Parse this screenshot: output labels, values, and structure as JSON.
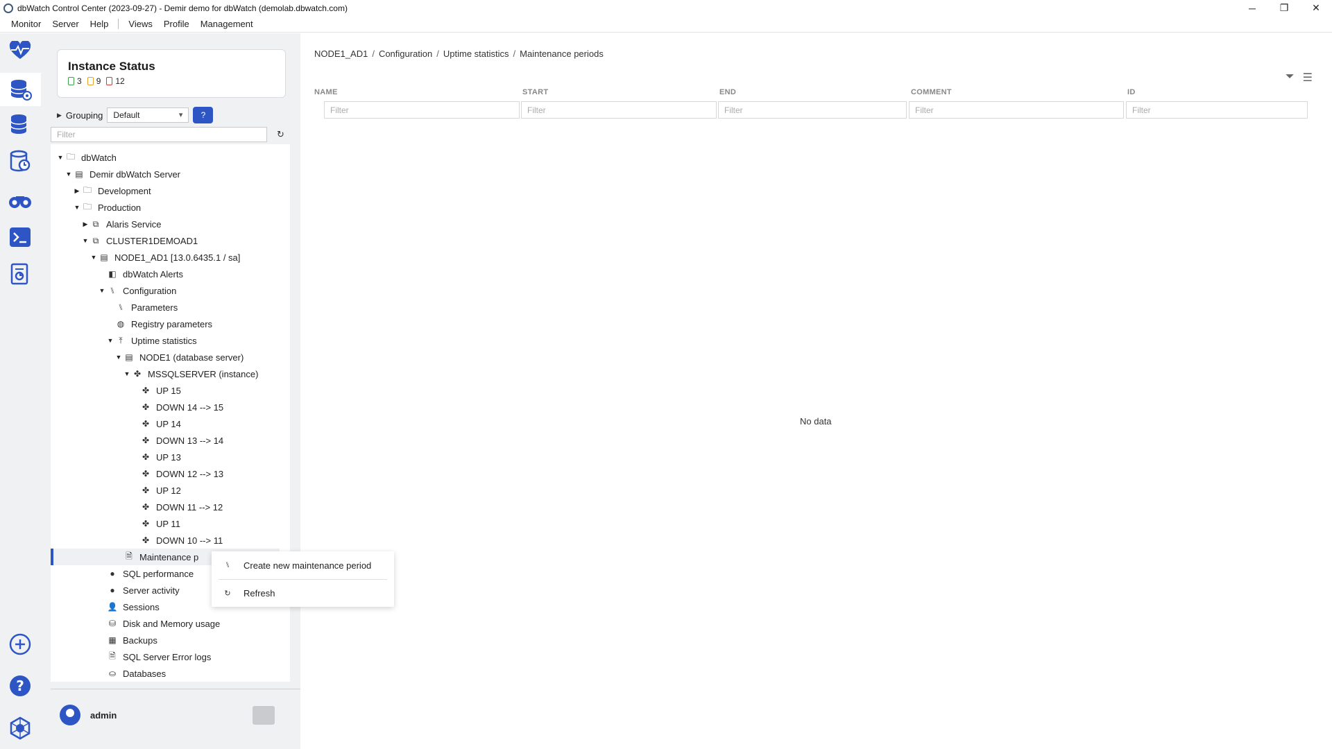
{
  "window": {
    "title": "dbWatch Control Center  (2023-09-27) - Demir demo for dbWatch (demolab.dbwatch.com)",
    "controls": {
      "minimize": "─",
      "restore": "❐",
      "close": "✕"
    }
  },
  "menubar": {
    "left": [
      "Monitor",
      "Server",
      "Help"
    ],
    "right": [
      "Views",
      "Profile",
      "Management"
    ]
  },
  "rail": {
    "icons": [
      "heartbeat-icon",
      "database-gear-icon",
      "database-stack-icon",
      "database-clock-icon",
      "binoculars-icon",
      "terminal-icon",
      "report-icon",
      "add-circle-icon",
      "help-circle-icon",
      "settings-hex-icon"
    ]
  },
  "instance_status": {
    "title": "Instance Status",
    "ok": "3",
    "warning": "9",
    "alarm": "12",
    "colors": {
      "ok": "#3aa04a",
      "warning": "#e8a020",
      "alarm": "#d23a2a"
    }
  },
  "grouping": {
    "label": "Grouping",
    "selected": "Default",
    "help_label": "?"
  },
  "tree_filter": {
    "placeholder": "Filter"
  },
  "tree": [
    {
      "label": "dbWatch",
      "arrow": "▼",
      "icon": "🗀",
      "indent": 0
    },
    {
      "label": "Demir dbWatch Server",
      "arrow": "▼",
      "icon": "▤",
      "indent": 1
    },
    {
      "label": "Development",
      "arrow": "▶",
      "icon": "🗀",
      "indent": 2
    },
    {
      "label": "Production",
      "arrow": "▼",
      "icon": "🗀",
      "indent": 2
    },
    {
      "label": "Alaris Service",
      "arrow": "▶",
      "icon": "⧉",
      "indent": 3
    },
    {
      "label": "CLUSTER1DEMOAD1",
      "arrow": "▼",
      "icon": "⧉",
      "indent": 3
    },
    {
      "label": "NODE1_AD1 [13.0.6435.1 / sa]",
      "arrow": "▼",
      "icon": "▤",
      "indent": 4
    },
    {
      "label": "dbWatch Alerts",
      "arrow": "",
      "icon": "◧",
      "indent": 5
    },
    {
      "label": "Configuration",
      "arrow": "▼",
      "icon": "⑊",
      "indent": 5
    },
    {
      "label": "Parameters",
      "arrow": "",
      "icon": "⑊",
      "indent": 6
    },
    {
      "label": "Registry parameters",
      "arrow": "",
      "icon": "◍",
      "indent": 6
    },
    {
      "label": "Uptime statistics",
      "arrow": "▼",
      "icon": "⤒",
      "indent": 6
    },
    {
      "label": "NODE1 (database server)",
      "arrow": "▼",
      "icon": "▤",
      "indent": 7
    },
    {
      "label": "MSSQLSERVER (instance)",
      "arrow": "▼",
      "icon": "✤",
      "indent": 8
    },
    {
      "label": "UP 15",
      "arrow": "",
      "icon": "✤",
      "indent": 9
    },
    {
      "label": "DOWN 14 --> 15",
      "arrow": "",
      "icon": "✤",
      "indent": 9
    },
    {
      "label": "UP 14",
      "arrow": "",
      "icon": "✤",
      "indent": 9
    },
    {
      "label": "DOWN 13 --> 14",
      "arrow": "",
      "icon": "✤",
      "indent": 9
    },
    {
      "label": "UP 13",
      "arrow": "",
      "icon": "✤",
      "indent": 9
    },
    {
      "label": "DOWN 12 --> 13",
      "arrow": "",
      "icon": "✤",
      "indent": 9
    },
    {
      "label": "UP 12",
      "arrow": "",
      "icon": "✤",
      "indent": 9
    },
    {
      "label": "DOWN 11 --> 12",
      "arrow": "",
      "icon": "✤",
      "indent": 9
    },
    {
      "label": "UP 11",
      "arrow": "",
      "icon": "✤",
      "indent": 9
    },
    {
      "label": "DOWN 10 --> 11",
      "arrow": "",
      "icon": "✤",
      "indent": 9
    },
    {
      "label": "Maintenance p",
      "arrow": "",
      "icon": "🗎",
      "indent": 7,
      "selected": true
    },
    {
      "label": "SQL performance",
      "arrow": "",
      "icon": "●",
      "indent": 5
    },
    {
      "label": "Server activity",
      "arrow": "",
      "icon": "●",
      "indent": 5
    },
    {
      "label": "Sessions",
      "arrow": "",
      "icon": "👤",
      "indent": 5
    },
    {
      "label": "Disk and Memory usage",
      "arrow": "",
      "icon": "⛁",
      "indent": 5
    },
    {
      "label": "Backups",
      "arrow": "",
      "icon": "▦",
      "indent": 5
    },
    {
      "label": "SQL Server Error logs",
      "arrow": "",
      "icon": "🗎",
      "indent": 5
    },
    {
      "label": "Databases",
      "arrow": "",
      "icon": "⛀",
      "indent": 5
    }
  ],
  "user": {
    "name": "admin"
  },
  "breadcrumb": [
    "NODE1_AD1",
    "Configuration",
    "Uptime statistics",
    "Maintenance periods"
  ],
  "breadcrumb_sep": "/",
  "grid": {
    "columns": [
      "NAME",
      "START",
      "END",
      "COMMENT",
      "ID"
    ],
    "filter_placeholder": "Filter",
    "empty_text": "No data"
  },
  "context_menu": {
    "items": [
      {
        "label": "Create new maintenance period",
        "icon": "⑊"
      },
      {
        "label": "Refresh",
        "icon": "↻"
      }
    ]
  }
}
